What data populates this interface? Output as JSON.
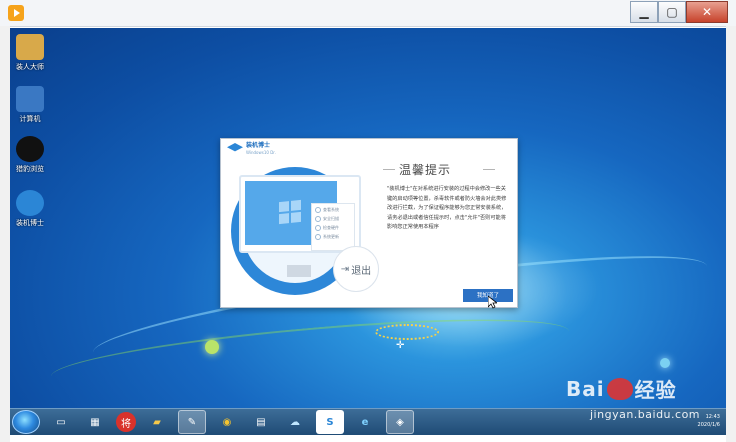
{
  "window": {
    "min_icon": "minimize-icon",
    "max_icon": "maximize-icon",
    "close_icon": "close-icon"
  },
  "desktop": {
    "icons": [
      {
        "label": "装人大师",
        "color": "#d8a94a"
      },
      {
        "label": "计算机",
        "color": "#3a78c3"
      },
      {
        "label": "猎豹浏览",
        "color": "#111111"
      },
      {
        "label": "装机博士",
        "color": "#2b86d6"
      }
    ]
  },
  "dialog": {
    "logo_text": "装机博士",
    "logo_sub": "Windows10 Dr.",
    "title": "温馨提示",
    "body": "\"装机博士\"在对系统进行安装的过程中会修改一些关键的启动项等位置，杀毒软件或者防火墙会对此类修改进行拦截，为了保证程序能够为您正常安装系统，请务必退出或者信任提示时，点击\"允许\"否则可能将影响您正常使用本程序",
    "panel_items": [
      "查看系统",
      "安全扫描",
      "检查硬件",
      "系统更新"
    ],
    "exit_label": "退出",
    "ok_button": "我知道了"
  },
  "taskbar": {
    "items": [
      {
        "icon": "desktop-icon",
        "glyph": "▭"
      },
      {
        "icon": "explorer-icon",
        "glyph": "▦"
      },
      {
        "icon": "app-jiang-icon",
        "glyph": "将"
      },
      {
        "icon": "folder-icon",
        "glyph": "▰"
      },
      {
        "icon": "tools-icon",
        "glyph": "✎"
      },
      {
        "icon": "chrome-icon",
        "glyph": "◉"
      },
      {
        "icon": "notepad-icon",
        "glyph": "▤"
      },
      {
        "icon": "cloud-icon",
        "glyph": "☁"
      },
      {
        "icon": "s-app-icon",
        "glyph": "S"
      },
      {
        "icon": "ie-icon",
        "glyph": "e"
      },
      {
        "icon": "zhuangji-icon",
        "glyph": "◈"
      }
    ],
    "clock_time": "12:43",
    "clock_date": "2020/1/6"
  },
  "watermark": {
    "brand": "Bai",
    "brand2": "经验",
    "url": "jingyan.baidu.com"
  }
}
